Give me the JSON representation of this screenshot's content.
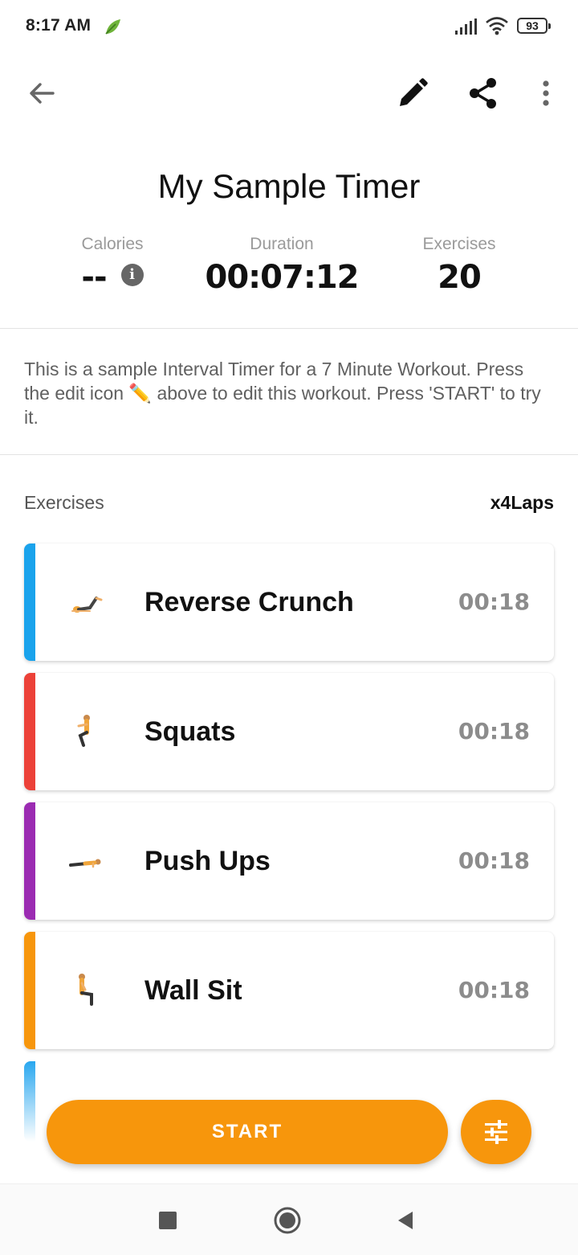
{
  "status_bar": {
    "time": "8:17 AM",
    "battery": "93"
  },
  "header": {
    "back_icon": "arrow-left-icon",
    "edit_icon": "pencil-icon",
    "share_icon": "share-icon",
    "more_icon": "more-vert-icon"
  },
  "workout": {
    "title": "My Sample Timer",
    "stats": {
      "calories_label": "Calories",
      "calories_value": "--",
      "duration_label": "Duration",
      "duration_value": "00:07:12",
      "exercises_label": "Exercises",
      "exercises_value": "20"
    },
    "description": "This is a sample Interval Timer for a 7 Minute Workout. Press the edit icon ✏️ above to edit this workout. Press 'START' to try it."
  },
  "exercises_section": {
    "label": "Exercises",
    "laps": "x4Laps",
    "items": [
      {
        "name": "Reverse Crunch",
        "time": "00:18",
        "color": "#1aa3ec",
        "thumb": "reverse-crunch-figure"
      },
      {
        "name": "Squats",
        "time": "00:18",
        "color": "#ec4138",
        "thumb": "squats-figure"
      },
      {
        "name": "Push Ups",
        "time": "00:18",
        "color": "#9b2bb2",
        "thumb": "push-ups-figure"
      },
      {
        "name": "Wall Sit",
        "time": "00:18",
        "color": "#f7960c",
        "thumb": "wall-sit-figure"
      }
    ]
  },
  "actions": {
    "start_label": "START",
    "settings_icon": "tune-sliders-icon"
  },
  "colors": {
    "accent": "#f7960c"
  }
}
